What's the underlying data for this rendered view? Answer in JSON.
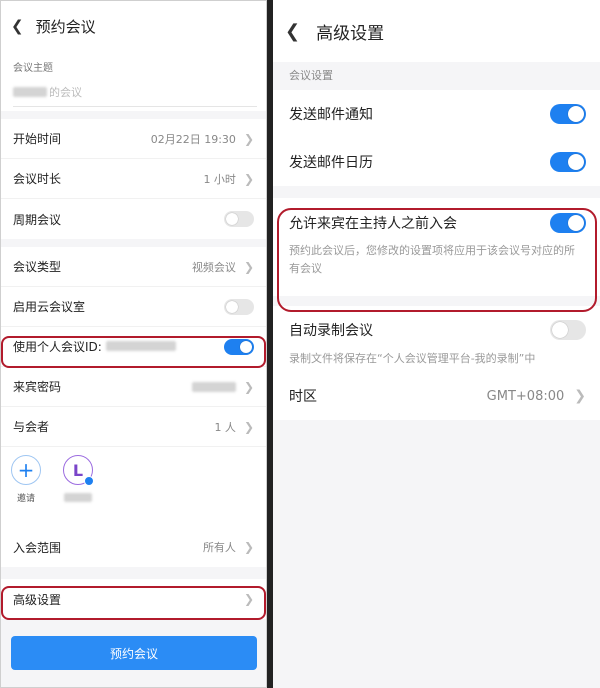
{
  "left": {
    "title": "预约会议",
    "topic_label": "会议主题",
    "topic_value": "的会议",
    "rows": {
      "start_time": {
        "label": "开始时间",
        "value": "02月22日 19:30"
      },
      "duration": {
        "label": "会议时长",
        "value": "1 小时"
      },
      "recurring": {
        "label": "周期会议",
        "toggle": false
      },
      "meeting_type": {
        "label": "会议类型",
        "value": "视频会议"
      },
      "cloud_room": {
        "label": "启用云会议室",
        "toggle": false
      },
      "personal_id": {
        "label": "使用个人会议ID:",
        "toggle": true
      },
      "guest_password": {
        "label": "来宾密码"
      },
      "attendees": {
        "label": "与会者",
        "value": "1 人"
      },
      "join_scope": {
        "label": "入会范围",
        "value": "所有人"
      },
      "advanced": {
        "label": "高级设置"
      }
    },
    "invite_label": "邀请",
    "avatar_initial": "L",
    "book_button": "预约会议"
  },
  "right": {
    "title": "高级设置",
    "group_label": "会议设置",
    "send_email_notice": {
      "label": "发送邮件通知",
      "toggle": true
    },
    "send_email_calendar": {
      "label": "发送邮件日历",
      "toggle": true
    },
    "allow_before_host": {
      "label": "允许来宾在主持人之前入会",
      "toggle": true,
      "description": "预约此会议后，您修改的设置项将应用于该会议号对应的所有会议"
    },
    "auto_record": {
      "label": "自动录制会议",
      "toggle": false,
      "description": "录制文件将保存在“个人会议管理平台-我的录制”中"
    },
    "timezone": {
      "label": "时区",
      "value": "GMT+08:00"
    }
  },
  "colors": {
    "accent": "#1e80f0",
    "highlight": "#b21b2c"
  }
}
